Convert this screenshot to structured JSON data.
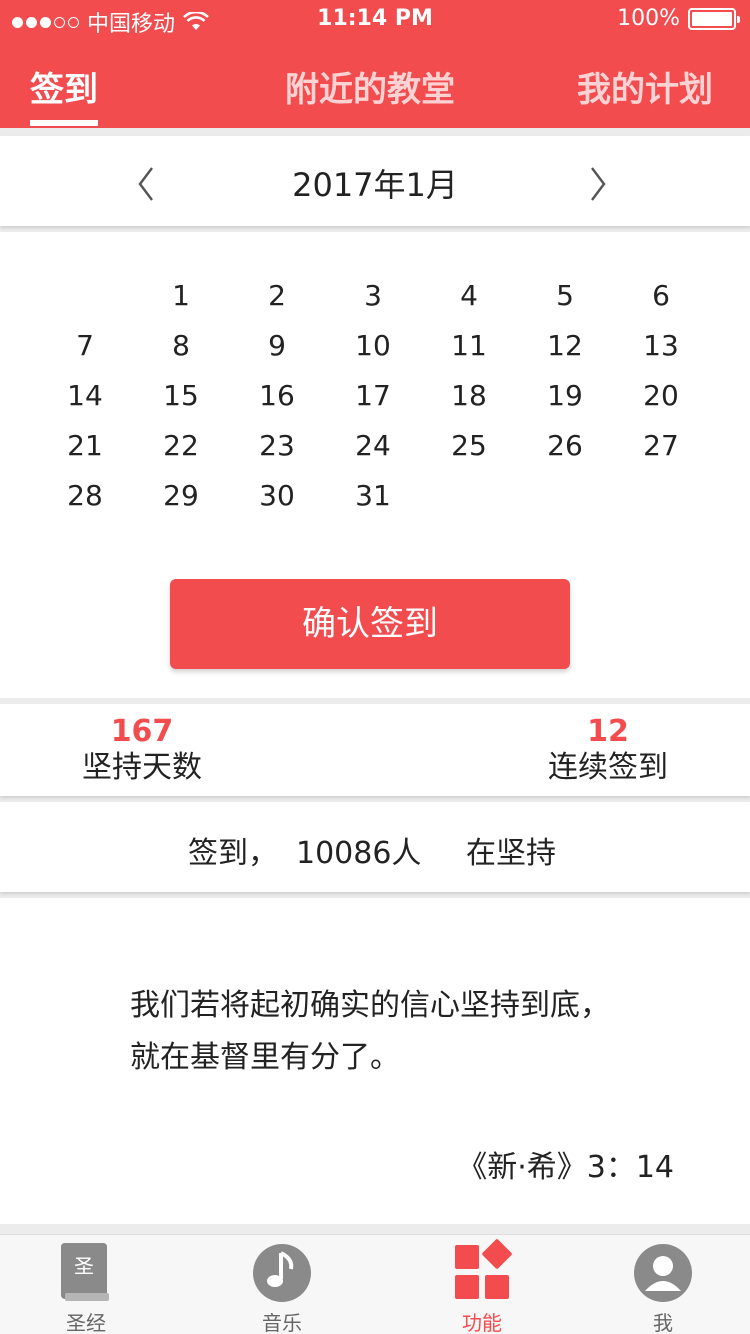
{
  "status_bar": {
    "carrier": "中国移动",
    "time": "11:14 PM",
    "battery": "100%"
  },
  "tabs": [
    {
      "label": "签到",
      "active": true
    },
    {
      "label": "附近的教堂",
      "active": false
    },
    {
      "label": "我的计划",
      "active": false
    }
  ],
  "month": {
    "title": "2017年1月"
  },
  "calendar": {
    "start_offset": 1,
    "days": [
      "1",
      "2",
      "3",
      "4",
      "5",
      "6",
      "7",
      "8",
      "9",
      "10",
      "11",
      "12",
      "13",
      "14",
      "15",
      "16",
      "17",
      "18",
      "19",
      "20",
      "21",
      "22",
      "23",
      "24",
      "25",
      "26",
      "27",
      "28",
      "29",
      "30",
      "31"
    ]
  },
  "confirm_button": "确认签到",
  "stats": {
    "total_days_value": "167",
    "total_days_label": "坚持天数",
    "streak_value": "12",
    "streak_label": "连续签到"
  },
  "summary": {
    "prefix": "签到，",
    "count": "10086人",
    "suffix": "在坚持"
  },
  "verse": {
    "line1": "我们若将起初确实的信心坚持到底，",
    "line2": "就在基督里有分了。",
    "reference": "《新·希》3：14"
  },
  "bottom_nav": [
    {
      "label": "圣经",
      "icon": "bible-icon",
      "icon_text": "圣",
      "active": false
    },
    {
      "label": "音乐",
      "icon": "music-icon",
      "active": false
    },
    {
      "label": "功能",
      "icon": "functions-icon",
      "active": true
    },
    {
      "label": "我",
      "icon": "profile-icon",
      "active": false
    }
  ],
  "colors": {
    "accent": "#f24c4f",
    "inactive_tab": "#ffd3d3"
  }
}
